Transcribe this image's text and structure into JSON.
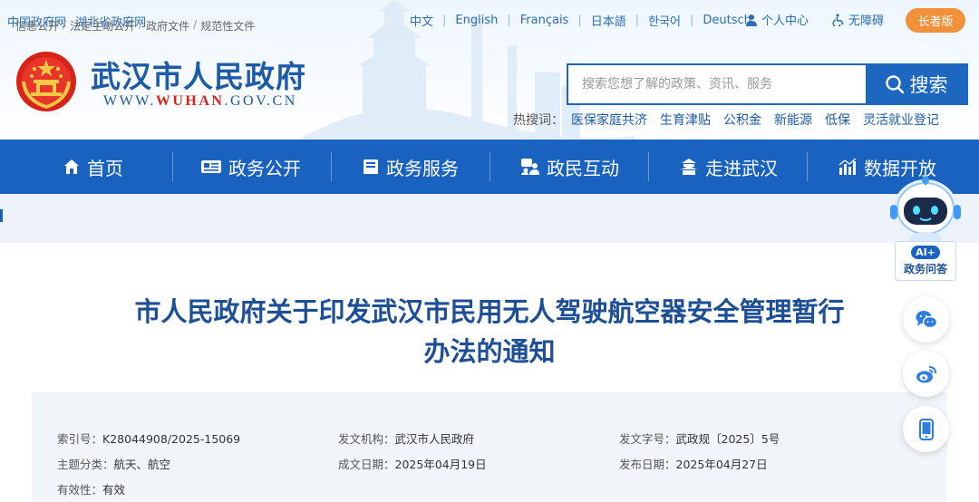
{
  "top_links": [
    "中国政府网",
    "湖北省政府网"
  ],
  "languages": [
    "中文",
    "English",
    "Français",
    "日本語",
    "한국어",
    "Deutsch"
  ],
  "utility": {
    "personal_center": "个人中心",
    "accessibility": "无障碍",
    "elder_mode": "长者版"
  },
  "site": {
    "title": "武汉市人民政府",
    "url_prefix": "WWW.",
    "url_brand": "WUHAN",
    "url_suffix": ".GOV.CN"
  },
  "search": {
    "placeholder": "搜索您想了解的政策、资讯、服务",
    "button_label": "搜索"
  },
  "hot_search": {
    "label": "热搜词：",
    "items": [
      "医保家庭共济",
      "生育津贴",
      "公积金",
      "新能源",
      "低保",
      "灵活就业登记"
    ]
  },
  "nav": [
    "首页",
    "政务公开",
    "政务服务",
    "政民互动",
    "走进武汉",
    "数据开放"
  ],
  "breadcrumb": [
    "信息公开",
    "法定主动公开",
    "政府文件",
    "规范性文件"
  ],
  "article": {
    "title_line1": "市人民政府关于印发武汉市民用无人驾驶航空器安全管理暂行",
    "title_line2": "办法的通知"
  },
  "meta": {
    "index_label": "索引号：",
    "index_value": "K28044908/2025-15069",
    "issuer_label": "发文机构：",
    "issuer_value": "武汉市人民政府",
    "docno_label": "发文字号：",
    "docno_value": "武政规〔2025〕5号",
    "topic_label": "主题分类：",
    "topic_value": "航天、航空",
    "created_label": "成文日期：",
    "created_value": "2025年04月19日",
    "published_label": "发布日期：",
    "published_value": "2025年04月27日",
    "validity_label": "有效性：",
    "validity_value": "有效"
  },
  "ai_assistant": {
    "badge": "AI+",
    "label": "政务问答"
  },
  "colors": {
    "primary": "#1a62bf",
    "title": "#1d4f96",
    "elder": "#f3913a",
    "url_red": "#d7241b"
  }
}
